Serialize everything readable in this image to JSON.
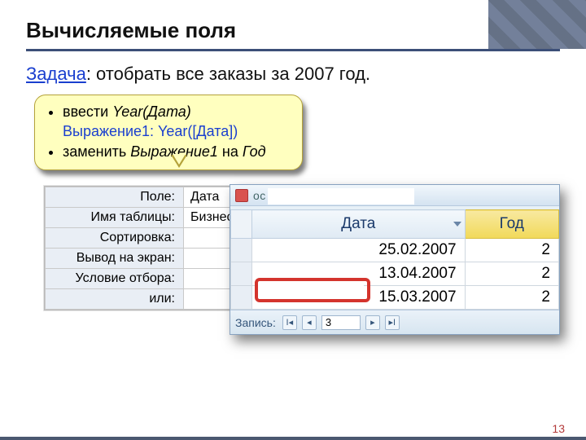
{
  "page": {
    "title": "Вычисляемые поля",
    "task_label": "Задача",
    "task_text": ": отобрать все заказы за 2007 год.",
    "page_number": "13"
  },
  "callout": {
    "line1a": "ввести ",
    "line1b": "Year",
    "line1c": "(Дата)",
    "expr": "Выражение1: Year([Дата])",
    "line2a": "заменить ",
    "line2b": "Выражение1",
    "line2c": " на ",
    "line2d": "Год"
  },
  "design_grid": {
    "labels": {
      "field": "Поле:",
      "table": "Имя таблицы:",
      "sort": "Сортировка:",
      "show": "Вывод на экран:",
      "criteria": "Условие отбора:",
      "or": "или:"
    },
    "values": {
      "field": "Дата",
      "table": "Бизнес"
    }
  },
  "datasheet": {
    "window_title": "ос",
    "col_date": "Дата",
    "col_year": "Год",
    "rows": [
      {
        "date": "25.02.2007",
        "year": "2"
      },
      {
        "date": "13.04.2007",
        "year": "2"
      },
      {
        "date": "15.03.2007",
        "year": "2"
      }
    ],
    "nav_label": "Запись:",
    "nav_value": "3"
  }
}
